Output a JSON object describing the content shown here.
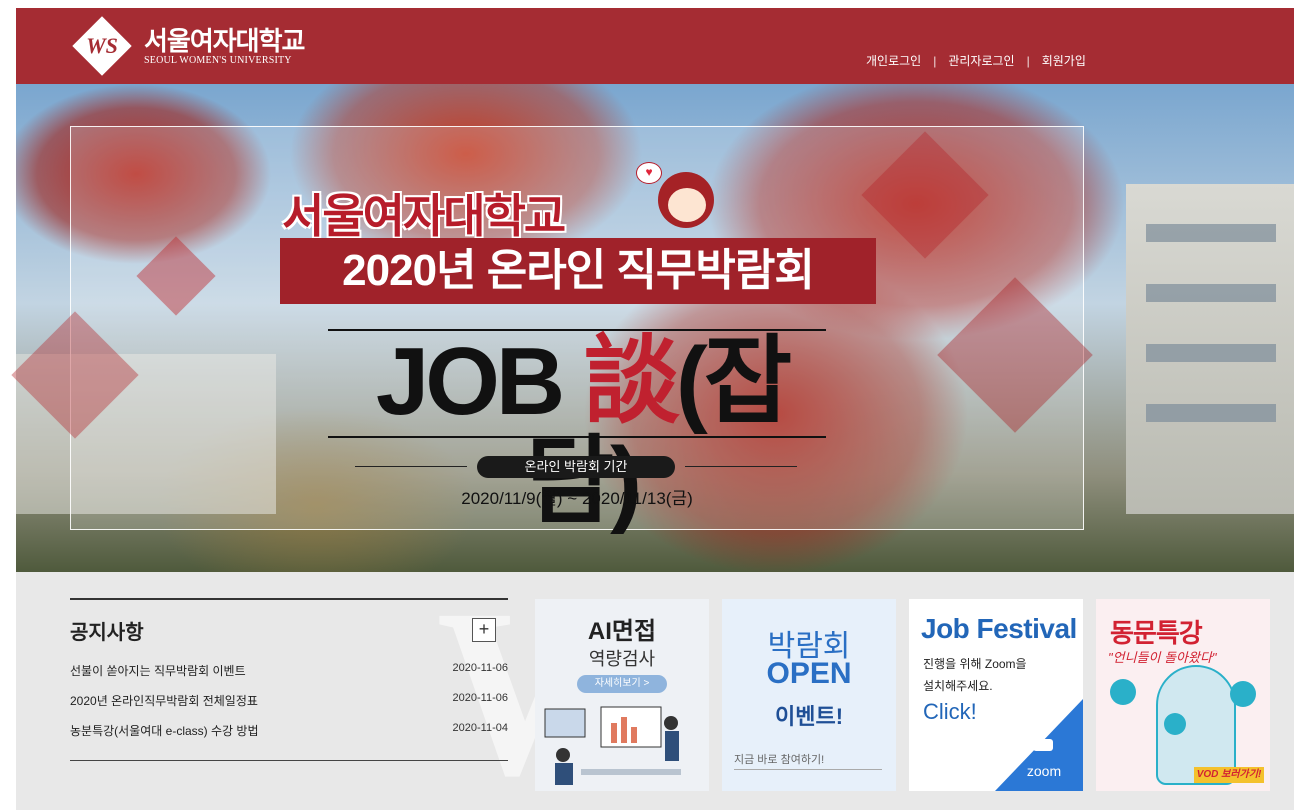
{
  "header": {
    "logo_symbol": "WS",
    "logo_ko": "서울여자대학교",
    "logo_en": "SEOUL WOMEN'S UNIVERSITY",
    "nav": [
      "개인로그인",
      "관리자로그인",
      "회원가입"
    ],
    "separator": "|"
  },
  "hero": {
    "title1": "서울여자대학교",
    "title2": "2020년 온라인 직무박람회",
    "title3_a": "JOB ",
    "title3_b": "談",
    "title3_c": "(잡담)",
    "period_label": "온라인 박람회 기간",
    "period": "2020/11/9(월) ~ 2020/11/13(금)",
    "heart": "♥"
  },
  "notice": {
    "title": "공지사항",
    "more_label": "+",
    "items": [
      {
        "title": "선불이 쏟아지는 직무박람회 이벤트",
        "date": "2020-11-06"
      },
      {
        "title": "2020년 온라인직무박람회 전체일정표",
        "date": "2020-11-06"
      },
      {
        "title": "농분특강(서울여대 e-class) 수강 방법",
        "date": "2020-11-04"
      }
    ]
  },
  "cards": {
    "ai": {
      "title": "AI면접",
      "subtitle": "역량검사",
      "button": "자세히보기 >"
    },
    "open": {
      "line1": "박람회",
      "line2": "OPEN",
      "line3": "이벤트!",
      "footer": "지금 바로 참여하기!"
    },
    "festival": {
      "title": "Job Festival",
      "line1": "진행을 위해 Zoom을",
      "line2": "설치해주세요.",
      "click": "Click!",
      "zoom": "zoom"
    },
    "alumni": {
      "title": "동문특강",
      "subtitle": "\"언니들이 돌아왔다\"",
      "vod": "VOD 보러가기!"
    }
  },
  "colors": {
    "brand": "#a52c33",
    "accent": "#2266b8"
  }
}
